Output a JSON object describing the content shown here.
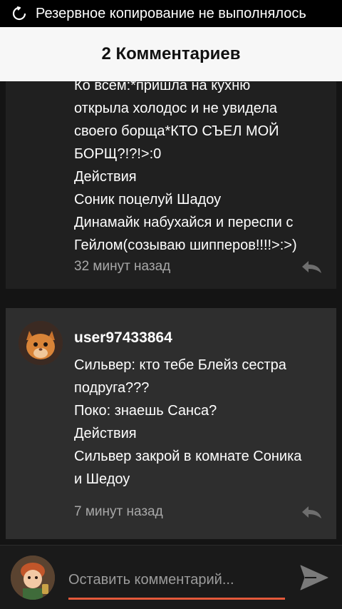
{
  "status_bar": {
    "text": "Резервное копирование не выполнялось",
    "icon": "sync-icon"
  },
  "header": {
    "title": "2 Комментариев"
  },
  "comments": [
    {
      "lines": [
        "Ко всем:*пришла на кухню",
        "открыла холодос и не увидела",
        "своего борща*КТО СЪЕЛ МОЙ",
        "БОРЩ?!?!>:0",
        "Действия",
        "Соник поцелуй Шадоу",
        "Динамайк набухайся и переспи с",
        "Гейлом(созываю шипперов!!!!>:>)"
      ],
      "timestamp": "32 минут назад",
      "reply_icon": "reply-icon"
    },
    {
      "username": "user97433864",
      "avatar_icon": "cat-avatar",
      "lines": [
        "Сильвер: кто тебе Блейз сестра",
        "подруга???",
        "Поко: знаешь Санса?",
        "Действия",
        "Сильвер закрой в комнате Соника",
        "и Шедоу"
      ],
      "timestamp": "7 минут назад",
      "reply_icon": "reply-icon"
    }
  ],
  "composer": {
    "placeholder": "Оставить комментарий...",
    "value": "",
    "send_icon": "send-icon",
    "avatar_icon": "my-avatar"
  },
  "colors": {
    "status_bar_bg": "#000000",
    "header_bg": "#f7f7f7",
    "comment_bg": "#2e2e2e",
    "input_underline": "#e3593a",
    "muted_text": "#a8a8a8"
  }
}
